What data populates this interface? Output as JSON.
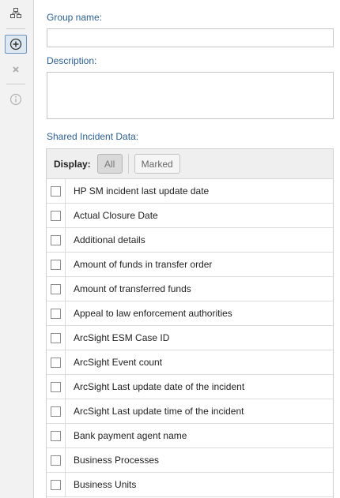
{
  "toolbar": {
    "buttons": [
      {
        "icon": "hierarchy-icon"
      },
      {
        "icon": "add-circle-icon"
      },
      {
        "icon": "close-icon"
      },
      {
        "icon": "info-icon"
      }
    ]
  },
  "form": {
    "group_name_label": "Group name:",
    "group_name_value": "",
    "description_label": "Description:",
    "description_value": "",
    "shared_label": "Shared Incident Data:"
  },
  "grid": {
    "display_label": "Display:",
    "filter_all": "All",
    "filter_marked": "Marked",
    "rows": [
      "HP SM incident last update date",
      "Actual Closure Date",
      "Additional details",
      "Amount of funds in transfer order",
      "Amount of transferred funds",
      "Appeal to law enforcement authorities",
      "ArcSight ESM Case ID",
      "ArcSight Event count",
      "ArcSight Last update date of the incident",
      "ArcSight Last update time of the incident",
      "Bank payment agent name",
      "Business Processes",
      "Business Units"
    ]
  }
}
